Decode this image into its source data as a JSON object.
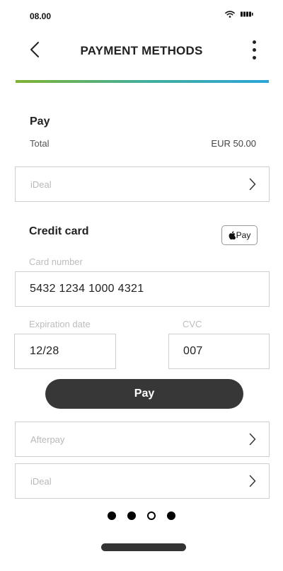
{
  "status_bar": {
    "time": "08.00",
    "icons": [
      "wifi-icon",
      "battery-icon"
    ]
  },
  "header": {
    "title": "PAYMENT METHODS",
    "back_icon": "chevron-left-icon",
    "menu_icon": "more-vertical-icon"
  },
  "colors": {
    "accent_start": "#7fb331",
    "accent_end": "#2aa5d8",
    "button": "#373737"
  },
  "summary": {
    "heading": "Pay",
    "total_label": "Total",
    "total_value": "EUR 50.00"
  },
  "methods_top": [
    {
      "label": "iDeal"
    }
  ],
  "credit_card": {
    "heading": "Credit card",
    "apple_pay_label": "Pay",
    "card_number_label": "Card number",
    "card_number_value": "5432 1234 1000 4321",
    "expiration_label": "Expiration date",
    "expiration_value": "12/28",
    "cvc_label": "CVC",
    "cvc_value": "007"
  },
  "pay_button_label": "Pay",
  "methods_bottom": [
    {
      "label": "Afterpay"
    },
    {
      "label": "iDeal"
    }
  ],
  "pager": {
    "count": 4,
    "active_index": 2
  }
}
